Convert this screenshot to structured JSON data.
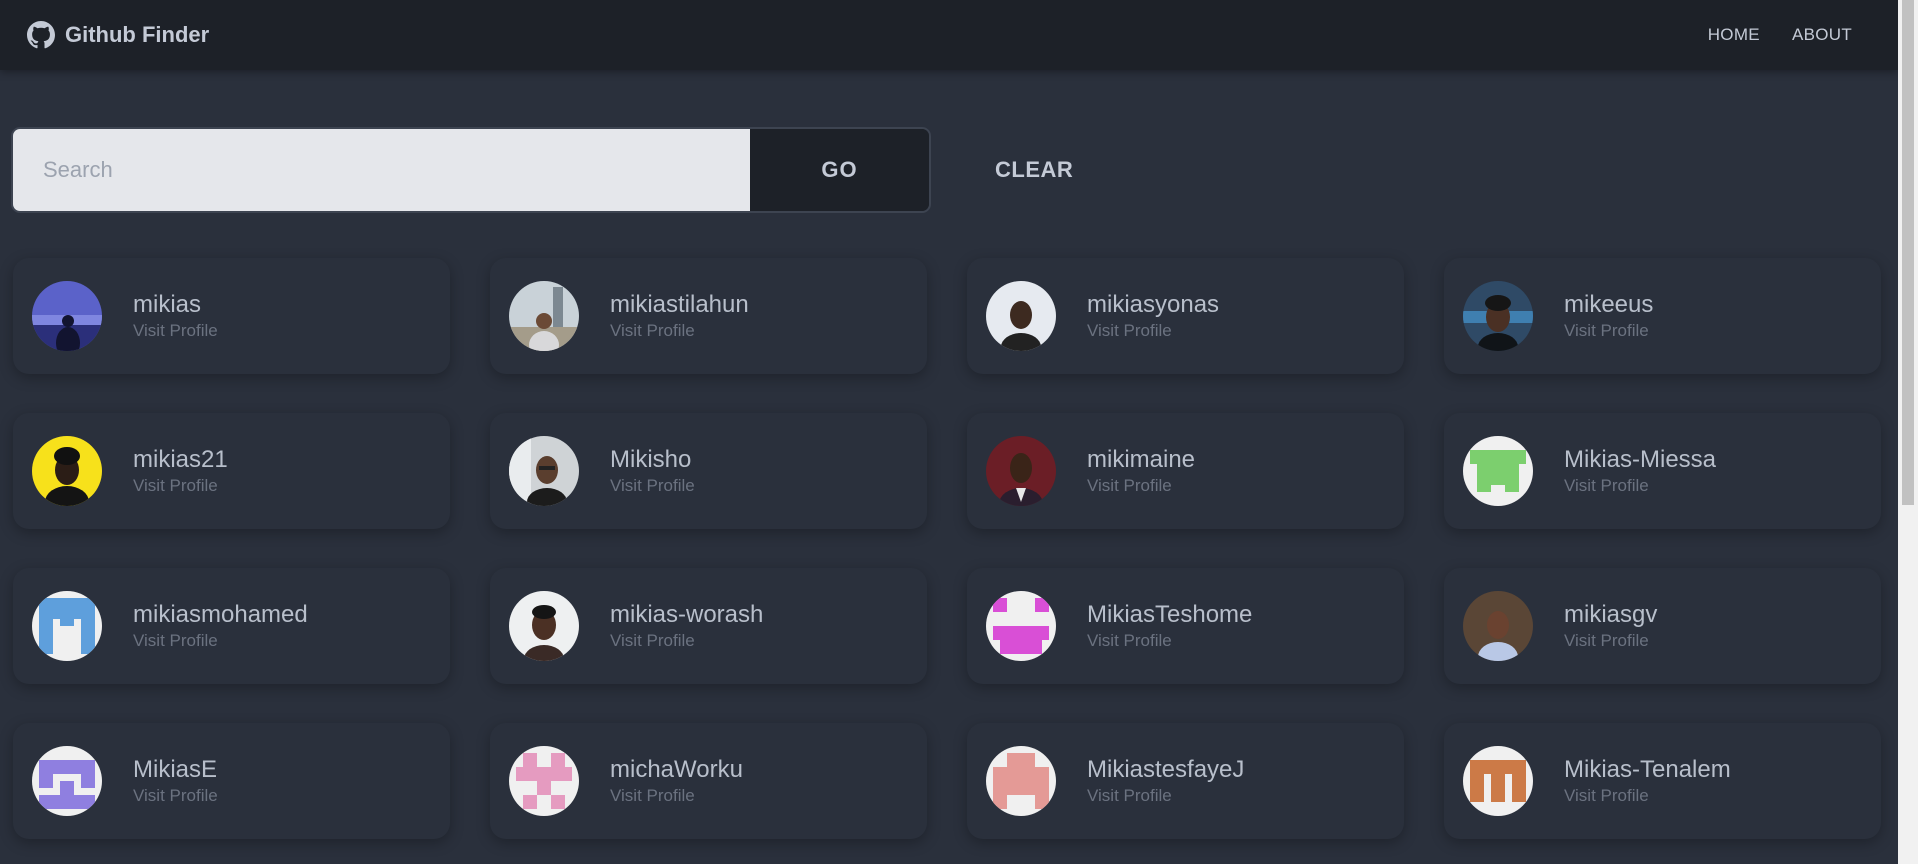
{
  "header": {
    "title": "Github Finder",
    "nav": [
      {
        "label": "HOME"
      },
      {
        "label": "ABOUT"
      }
    ]
  },
  "search": {
    "placeholder": "Search",
    "value": "",
    "go_label": "GO",
    "clear_label": "CLEAR"
  },
  "users": [
    {
      "login": "mikias",
      "link": "Visit Profile",
      "avatar": "photo"
    },
    {
      "login": "mikiastilahun",
      "link": "Visit Profile",
      "avatar": "photo"
    },
    {
      "login": "mikiasyonas",
      "link": "Visit Profile",
      "avatar": "photo"
    },
    {
      "login": "mikeeus",
      "link": "Visit Profile",
      "avatar": "photo"
    },
    {
      "login": "mikias21",
      "link": "Visit Profile",
      "avatar": "photo"
    },
    {
      "login": "Mikisho",
      "link": "Visit Profile",
      "avatar": "photo"
    },
    {
      "login": "mikimaine",
      "link": "Visit Profile",
      "avatar": "photo"
    },
    {
      "login": "Mikias-Miessa",
      "link": "Visit Profile",
      "avatar": "identicon"
    },
    {
      "login": "mikiasmohamed",
      "link": "Visit Profile",
      "avatar": "identicon"
    },
    {
      "login": "mikias-worash",
      "link": "Visit Profile",
      "avatar": "photo"
    },
    {
      "login": "MikiasTeshome",
      "link": "Visit Profile",
      "avatar": "identicon"
    },
    {
      "login": "mikiasgv",
      "link": "Visit Profile",
      "avatar": "photo"
    },
    {
      "login": "MikiasE",
      "link": "Visit Profile",
      "avatar": "identicon"
    },
    {
      "login": "michaWorku",
      "link": "Visit Profile",
      "avatar": "identicon"
    },
    {
      "login": "MikiastesfayeJ",
      "link": "Visit Profile",
      "avatar": "identicon"
    },
    {
      "login": "Mikias-Tenalem",
      "link": "Visit Profile",
      "avatar": "identicon"
    }
  ],
  "colors": {
    "background": "#2a303c",
    "navbar": "#1d2128",
    "input": "#e5e7eb",
    "identicon_green": "#7ccf6e",
    "identicon_blue": "#5e9fdc",
    "identicon_magenta": "#d94fd6",
    "identicon_purple": "#8f7fe0",
    "identicon_pink": "#e59bc0",
    "identicon_salmon": "#e49a96",
    "identicon_orange": "#cc7a47"
  }
}
